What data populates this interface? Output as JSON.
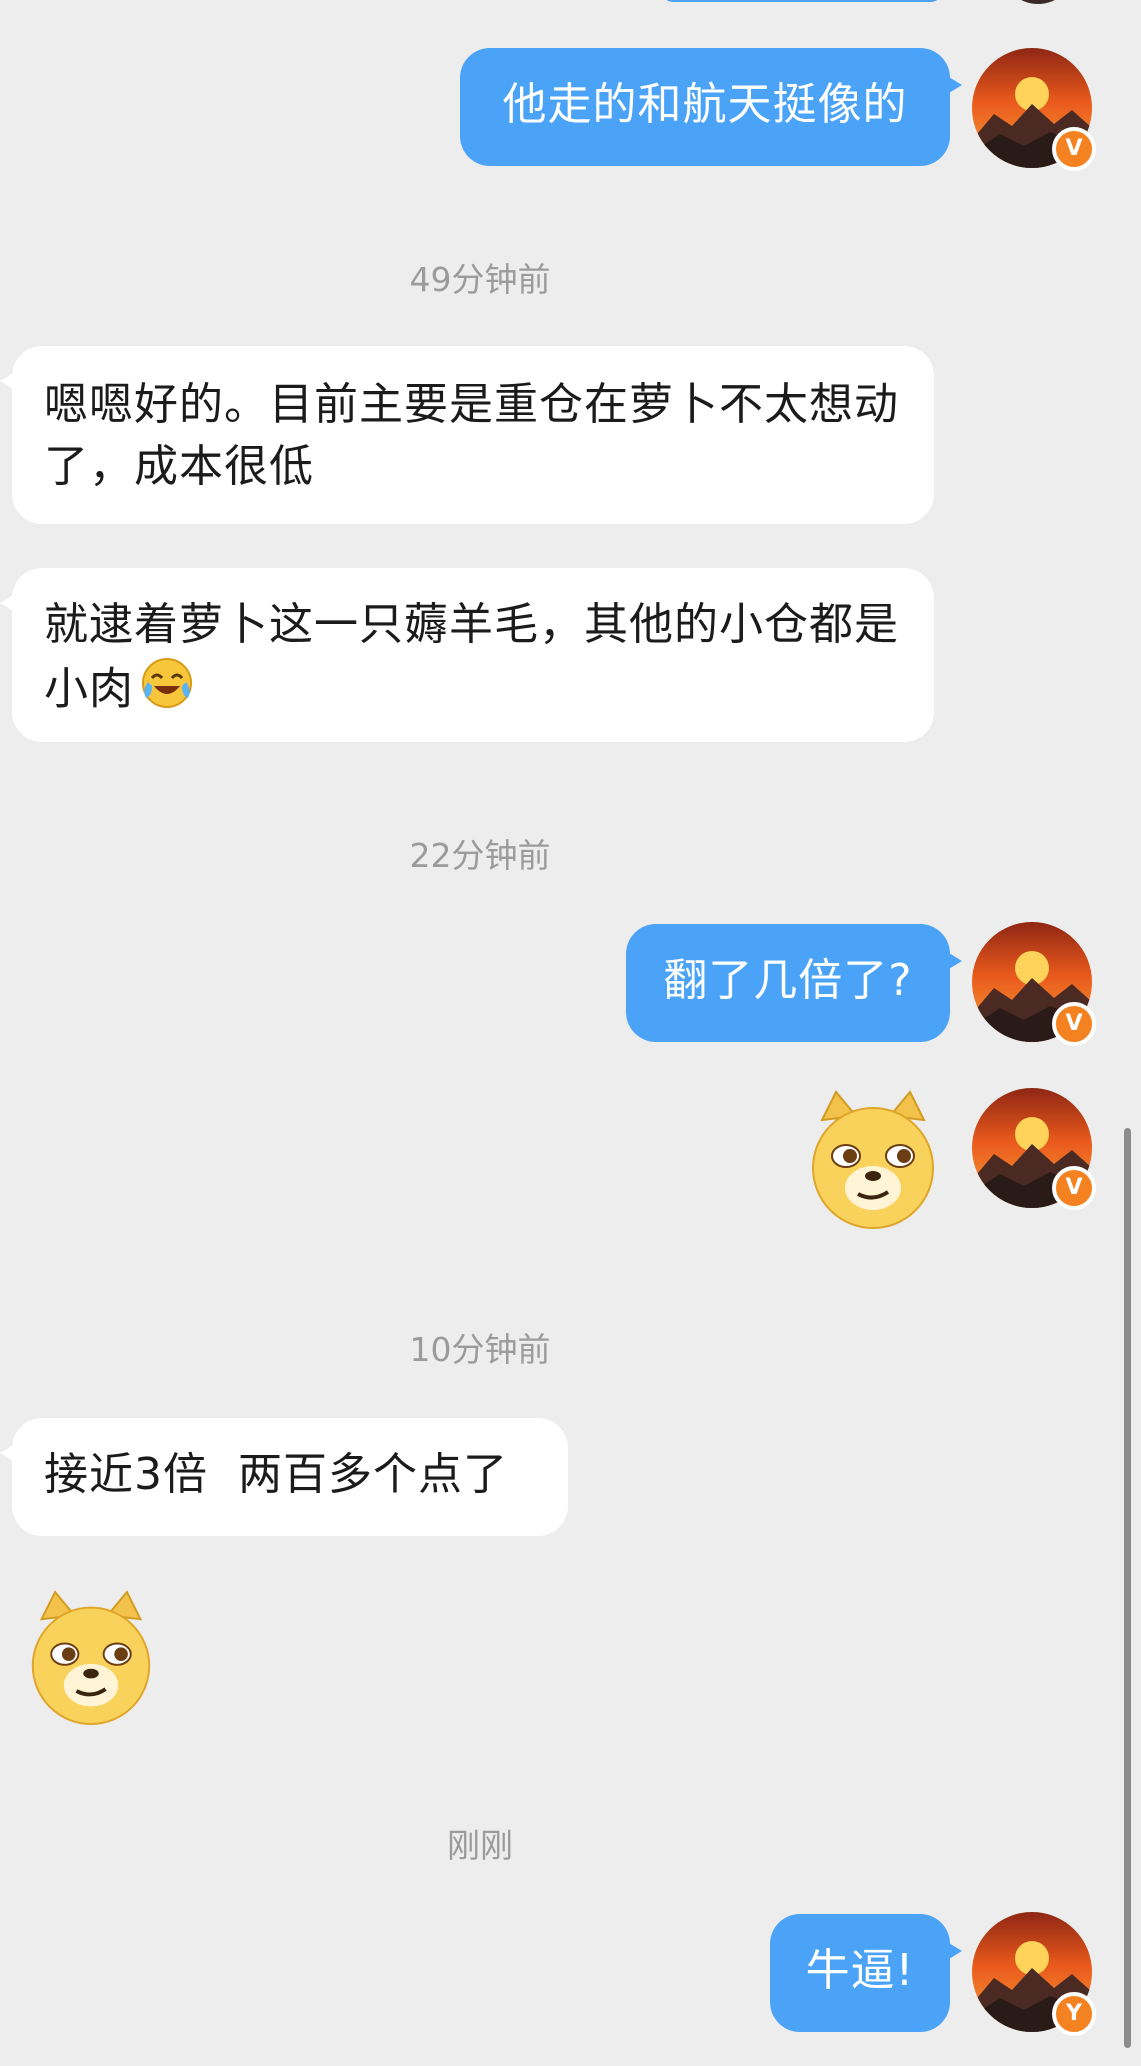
{
  "messages": [
    {
      "id": "m1",
      "sender": "me",
      "text": "他走的和航天挺像的"
    },
    {
      "time": "49分钟前"
    },
    {
      "id": "m2",
      "sender": "them",
      "text": "嗯嗯好的。目前主要是重仓在萝卜不太想动了，成本很低"
    },
    {
      "id": "m3",
      "sender": "them",
      "text": "就逮着萝卜这一只薅羊毛，其他的小仓都是小肉",
      "emoji": "laughing-crying-emoji"
    },
    {
      "time": "22分钟前"
    },
    {
      "id": "m4",
      "sender": "me",
      "text": "翻了几倍了?"
    },
    {
      "id": "m5",
      "sender": "me",
      "sticker": "doge-sticker"
    },
    {
      "time": "10分钟前"
    },
    {
      "id": "m6",
      "sender": "them",
      "text": "接近3倍  两百多个点了"
    },
    {
      "id": "m7",
      "sender": "them",
      "sticker": "doge-sticker"
    },
    {
      "time": "刚刚"
    },
    {
      "id": "m8",
      "sender": "me",
      "text": "牛逼!"
    }
  ],
  "time_labels": {
    "t49": "49分钟前",
    "t22": "22分钟前",
    "t10": "10分钟前",
    "tnow": "刚刚"
  },
  "bubbles": {
    "m1": "他走的和航天挺像的",
    "m2": "嗯嗯好的。目前主要是重仓在萝卜不太想动了，成本很低",
    "m3": "就逮着萝卜这一只薅羊毛，其他的小仓都是小肉",
    "m4": "翻了几倍了?",
    "m6": "接近3倍  两百多个点了",
    "m8": "牛逼!"
  },
  "badges": {
    "v": "V",
    "y": "Y"
  },
  "colors": {
    "background": "#ededed",
    "my_bubble": "#4ba3f7",
    "their_bubble": "#ffffff",
    "timestamp": "#9b9b9b",
    "verified_badge": "#f58220"
  },
  "icons": {
    "avatar": "sunset-mountain-avatar",
    "badge": "verified-badge-icon",
    "sticker": "doge-sticker",
    "inline_emoji": "laughing-crying-emoji"
  }
}
